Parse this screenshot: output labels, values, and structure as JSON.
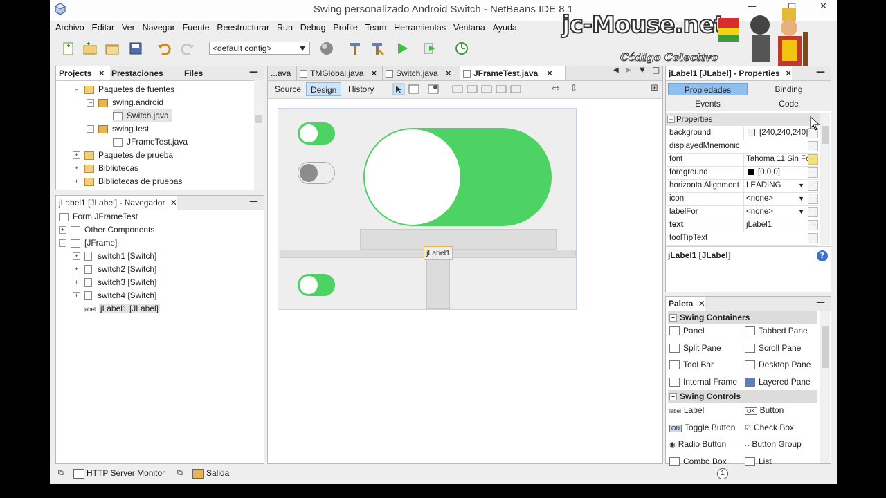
{
  "window": {
    "title": "Swing personalizado Android Switch - NetBeans IDE 8.1"
  },
  "watermark": {
    "brand": "jc-Mouse.net",
    "tagline": "Código Colectivo"
  },
  "menu": [
    "Archivo",
    "Editar",
    "Ver",
    "Navegar",
    "Fuente",
    "Reestructurar",
    "Run",
    "Debug",
    "Profile",
    "Team",
    "Herramientas",
    "Ventana",
    "Ayuda"
  ],
  "toolbar": {
    "config": "<default config>"
  },
  "projects": {
    "tabs": [
      "Projects",
      "Prestaciones",
      "Files"
    ],
    "tree": [
      "Paquetes de fuentes",
      "swing.android",
      "Switch.java",
      "swing.test",
      "JFrameTest.java",
      "Paquetes de prueba",
      "Bibliotecas",
      "Bibliotecas de pruebas"
    ]
  },
  "navigator": {
    "title": "jLabel1 [JLabel] - Navegador",
    "tree": [
      "Form JFrameTest",
      "Other Components",
      "[JFrame]",
      "switch1 [Switch]",
      "switch2 [Switch]",
      "switch3 [Switch]",
      "switch4 [Switch]",
      "jLabel1 [JLabel]"
    ],
    "label_icon": "label"
  },
  "editor": {
    "tabs": [
      "...ava",
      "TMGlobal.java",
      "Switch.java",
      "JFrameTest.java"
    ],
    "subtabs": [
      "Source",
      "Design",
      "History"
    ],
    "canvas_label": "jLabel1",
    "colors": {
      "on": "#4cd364",
      "off_knob": "#8c8c8c"
    }
  },
  "properties": {
    "title": "jLabel1 [JLabel] - Properties",
    "tabs": [
      "Propiedades",
      "Binding",
      "Events",
      "Code"
    ],
    "section": "Properties",
    "rows": [
      {
        "name": "background",
        "value": "[240,240,240]"
      },
      {
        "name": "displayedMnemonic",
        "value": ""
      },
      {
        "name": "font",
        "value": "Tahoma 11 Sin Fo"
      },
      {
        "name": "foreground",
        "value": "[0,0,0]"
      },
      {
        "name": "horizontalAlignment",
        "value": "LEADING"
      },
      {
        "name": "icon",
        "value": "<none>"
      },
      {
        "name": "labelFor",
        "value": "<none>"
      },
      {
        "name": "text",
        "value": "jLabel1"
      },
      {
        "name": "toolTipText",
        "value": ""
      }
    ],
    "description": "jLabel1 [JLabel]",
    "help": "?"
  },
  "palette": {
    "title": "Paleta",
    "containers_title": "Swing Containers",
    "containers": [
      "Panel",
      "Tabbed Pane",
      "Split Pane",
      "Scroll Pane",
      "Tool Bar",
      "Desktop Pane",
      "Internal Frame",
      "Layered Pane"
    ],
    "controls_title": "Swing Controls",
    "controls": [
      "Label",
      "Button",
      "Toggle Button",
      "Check Box",
      "Radio Button",
      "Button Group",
      "Combo Box",
      "List"
    ],
    "control_icons": [
      "label",
      "OK",
      "ON"
    ]
  },
  "statusbar": {
    "items": [
      "HTTP Server Monitor",
      "Salida"
    ],
    "badge": "1"
  }
}
